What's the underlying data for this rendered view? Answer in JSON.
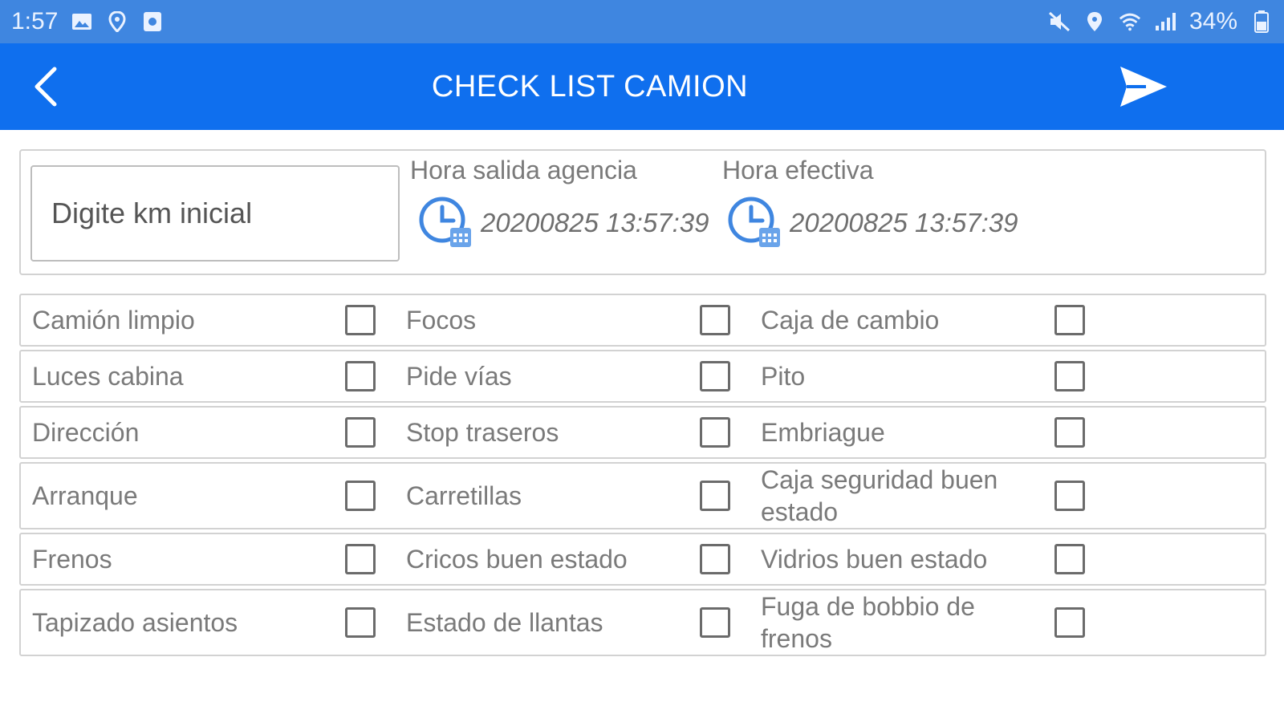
{
  "status_bar": {
    "time": "1:57",
    "battery": "34%",
    "left_icons": [
      "image-icon",
      "location-icon",
      "notification-icon"
    ],
    "right_icons": [
      "mute-icon",
      "location-icon",
      "wifi-icon",
      "signal-icon",
      "battery-icon"
    ]
  },
  "app_bar": {
    "title": "CHECK LIST CAMION",
    "back_icon": "back-arrow-icon",
    "send_icon": "send-icon",
    "color": "#0f6fee"
  },
  "header": {
    "km_input": {
      "placeholder": "Digite km inicial",
      "value": ""
    },
    "departure": {
      "label": "Hora salida agencia",
      "value": "20200825 13:57:39"
    },
    "effective": {
      "label": "Hora efectiva",
      "value": "20200825 13:57:39"
    }
  },
  "checklist": {
    "rows": [
      {
        "items": [
          {
            "label": "Camión limpio",
            "checked": false
          },
          {
            "label": "Focos",
            "checked": false
          },
          {
            "label": "Caja de cambio",
            "checked": false
          }
        ]
      },
      {
        "items": [
          {
            "label": "Luces cabina",
            "checked": false
          },
          {
            "label": "Pide vías",
            "checked": false
          },
          {
            "label": "Pito",
            "checked": false
          }
        ]
      },
      {
        "items": [
          {
            "label": "Dirección",
            "checked": false
          },
          {
            "label": "Stop traseros",
            "checked": false
          },
          {
            "label": "Embriague",
            "checked": false
          }
        ]
      },
      {
        "items": [
          {
            "label": "Arranque",
            "checked": false
          },
          {
            "label": "Carretillas",
            "checked": false
          },
          {
            "label": "Caja seguridad buen estado",
            "checked": false
          }
        ]
      },
      {
        "items": [
          {
            "label": "Frenos",
            "checked": false
          },
          {
            "label": "Cricos buen estado",
            "checked": false
          },
          {
            "label": "Vidrios buen estado",
            "checked": false
          }
        ]
      },
      {
        "items": [
          {
            "label": "Tapizado asientos",
            "checked": false
          },
          {
            "label": "Estado de llantas",
            "checked": false
          },
          {
            "label": "Fuga de bobbio de frenos",
            "checked": false
          }
        ]
      }
    ]
  }
}
